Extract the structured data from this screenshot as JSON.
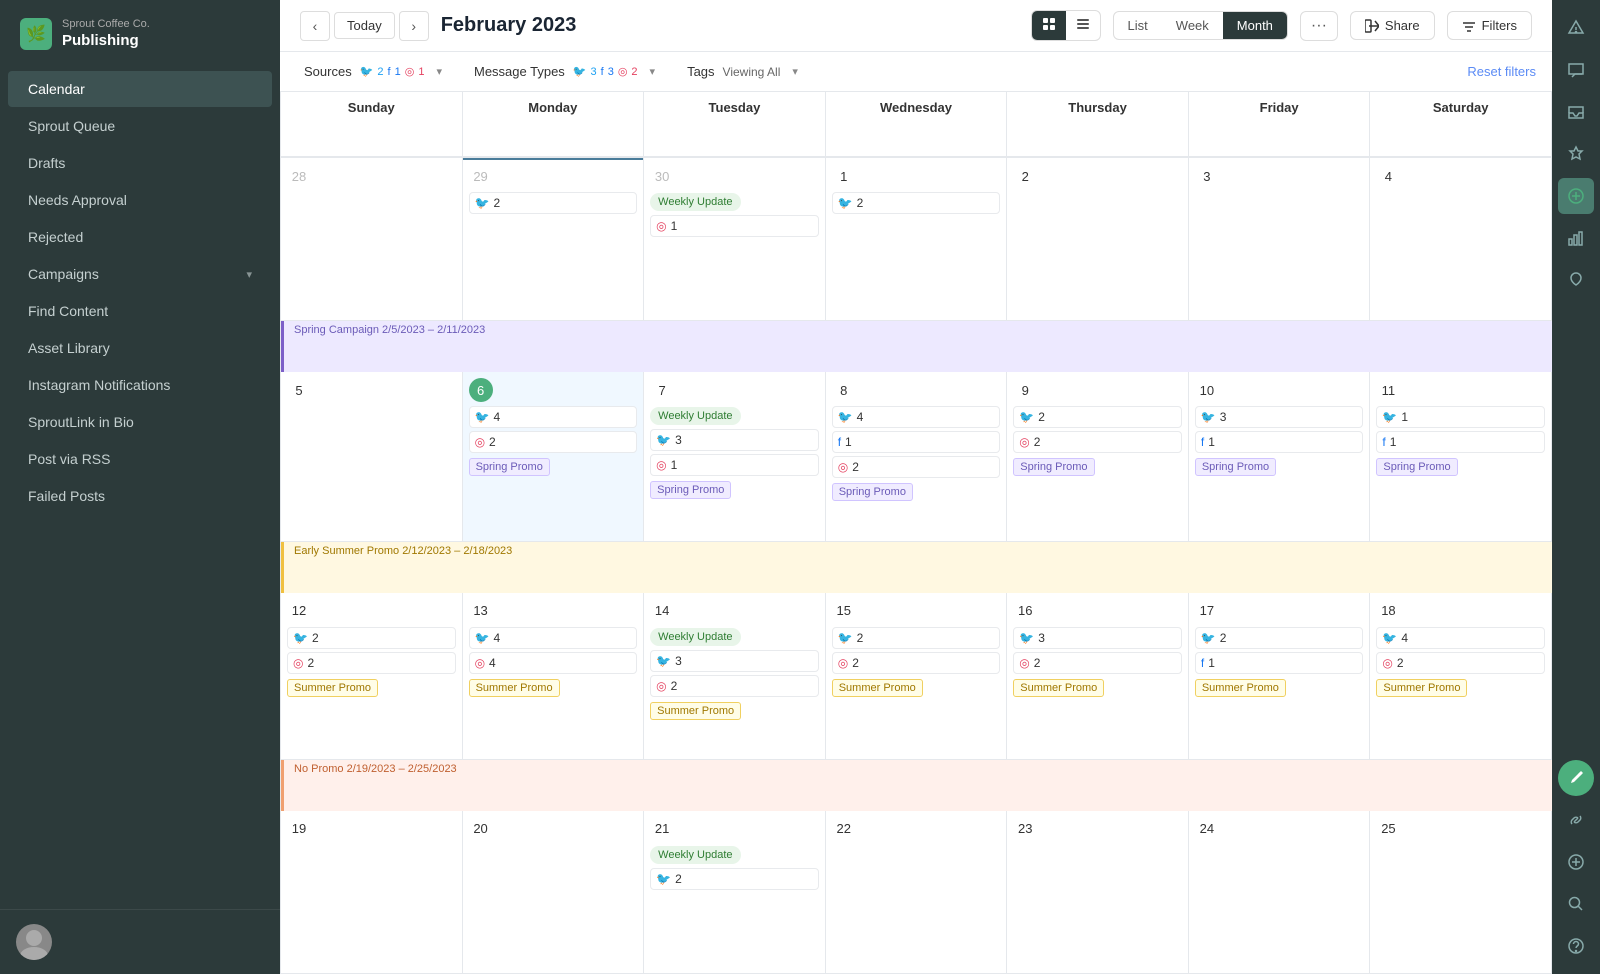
{
  "brand": {
    "company": "Sprout Coffee Co.",
    "app": "Publishing",
    "logo_char": "🌿"
  },
  "sidebar": {
    "items": [
      {
        "label": "Calendar",
        "active": true
      },
      {
        "label": "Sprout Queue"
      },
      {
        "label": "Drafts"
      },
      {
        "label": "Needs Approval"
      },
      {
        "label": "Rejected"
      },
      {
        "label": "Campaigns",
        "has_chevron": true
      },
      {
        "label": "Find Content"
      },
      {
        "label": "Asset Library"
      },
      {
        "label": "Instagram Notifications"
      },
      {
        "label": "SproutLink in Bio"
      },
      {
        "label": "Post via RSS"
      },
      {
        "label": "Failed Posts"
      }
    ]
  },
  "header": {
    "title": "February 2023",
    "today_label": "Today",
    "view_toggle": [
      "grid",
      "list"
    ],
    "view_tabs": [
      "List",
      "Week",
      "Month"
    ],
    "active_tab": "Month",
    "more_label": "···",
    "share_label": "Share",
    "filters_label": "Filters"
  },
  "filters": {
    "sources_label": "Sources",
    "sources_counts": {
      "twitter": 2,
      "facebook": 1,
      "instagram": 1
    },
    "message_types_label": "Message Types",
    "message_types_counts": {
      "twitter": 3,
      "facebook": 3,
      "instagram": 2
    },
    "tags_label": "Tags",
    "tags_value": "Viewing All",
    "reset_label": "Reset filters"
  },
  "calendar": {
    "day_headers": [
      "Sunday",
      "Monday",
      "Tuesday",
      "Wednesday",
      "Thursday",
      "Friday",
      "Saturday"
    ],
    "weeks": [
      {
        "days": [
          {
            "num": "28",
            "other": true,
            "posts": []
          },
          {
            "num": "29",
            "other": true,
            "posts": [
              {
                "type": "tw",
                "count": 2
              }
            ]
          },
          {
            "num": "30",
            "other": true,
            "weekly_update": true,
            "posts": [
              {
                "type": "ig",
                "count": 1
              }
            ]
          },
          {
            "num": "1",
            "posts": [
              {
                "type": "tw",
                "count": 2
              }
            ]
          },
          {
            "num": "2",
            "posts": []
          },
          {
            "num": "3",
            "posts": []
          },
          {
            "num": "4",
            "posts": []
          }
        ]
      },
      {
        "campaign": {
          "label": "Spring Campaign 2/5/2023 – 2/11/2023",
          "style": "spring"
        },
        "days": [
          {
            "num": "5",
            "posts": []
          },
          {
            "num": "6",
            "today": true,
            "posts": [
              {
                "type": "tw",
                "count": 4
              },
              {
                "type": "ig",
                "count": 2,
                "promo": "Spring Promo",
                "promo_style": "purple"
              }
            ]
          },
          {
            "num": "7",
            "weekly_update": true,
            "posts": [
              {
                "type": "tw",
                "count": 3
              },
              {
                "type": "ig",
                "count": 1,
                "promo": "Spring Promo",
                "promo_style": "purple"
              }
            ]
          },
          {
            "num": "8",
            "posts": [
              {
                "type": "tw",
                "count": 4
              },
              {
                "type": "fb",
                "count": 1
              },
              {
                "type": "ig",
                "count": 2,
                "promo": "Spring Promo",
                "promo_style": "purple"
              }
            ]
          },
          {
            "num": "9",
            "posts": [
              {
                "type": "tw",
                "count": 2
              },
              {
                "type": "ig",
                "count": 2,
                "promo": "Spring Promo",
                "promo_style": "purple"
              }
            ]
          },
          {
            "num": "10",
            "posts": [
              {
                "type": "tw",
                "count": 3
              },
              {
                "type": "fb",
                "count": 1,
                "promo": "Spring Promo",
                "promo_style": "purple"
              }
            ]
          },
          {
            "num": "11",
            "posts": [
              {
                "type": "tw",
                "count": 1
              },
              {
                "type": "fb",
                "count": 1,
                "promo": "Spring Promo",
                "promo_style": "purple"
              }
            ]
          }
        ]
      },
      {
        "campaign": {
          "label": "Early Summer Promo 2/12/2023 – 2/18/2023",
          "style": "summer"
        },
        "days": [
          {
            "num": "12",
            "posts": [
              {
                "type": "tw",
                "count": 2
              },
              {
                "type": "ig",
                "count": 2,
                "promo": "Summer Promo",
                "promo_style": "yellow"
              }
            ]
          },
          {
            "num": "13",
            "posts": [
              {
                "type": "tw",
                "count": 4
              },
              {
                "type": "ig",
                "count": 4,
                "promo": "Summer Promo",
                "promo_style": "yellow"
              }
            ]
          },
          {
            "num": "14",
            "weekly_update": true,
            "posts": [
              {
                "type": "tw",
                "count": 3
              },
              {
                "type": "ig",
                "count": 2,
                "promo": "Summer Promo",
                "promo_style": "yellow"
              }
            ]
          },
          {
            "num": "15",
            "posts": [
              {
                "type": "tw",
                "count": 2
              },
              {
                "type": "ig",
                "count": 2,
                "promo": "Summer Promo",
                "promo_style": "yellow"
              }
            ]
          },
          {
            "num": "16",
            "posts": [
              {
                "type": "tw",
                "count": 3
              },
              {
                "type": "ig",
                "count": 2,
                "promo": "Summer Promo",
                "promo_style": "yellow"
              }
            ]
          },
          {
            "num": "17",
            "posts": [
              {
                "type": "tw",
                "count": 2
              },
              {
                "type": "fb",
                "count": 1,
                "promo": "Summer Promo",
                "promo_style": "yellow"
              }
            ]
          },
          {
            "num": "18",
            "posts": [
              {
                "type": "tw",
                "count": 4
              },
              {
                "type": "ig",
                "count": 2,
                "promo": "Summer Promo",
                "promo_style": "yellow"
              }
            ]
          }
        ]
      },
      {
        "campaign": {
          "label": "No Promo 2/19/2023 – 2/25/2023",
          "style": "nopromo"
        },
        "days": [
          {
            "num": "19",
            "posts": []
          },
          {
            "num": "20",
            "posts": []
          },
          {
            "num": "21",
            "weekly_update": true,
            "posts": [
              {
                "type": "tw",
                "count": 2
              }
            ]
          },
          {
            "num": "22",
            "posts": []
          },
          {
            "num": "23",
            "posts": []
          },
          {
            "num": "24",
            "posts": []
          },
          {
            "num": "25",
            "posts": []
          }
        ]
      }
    ]
  }
}
